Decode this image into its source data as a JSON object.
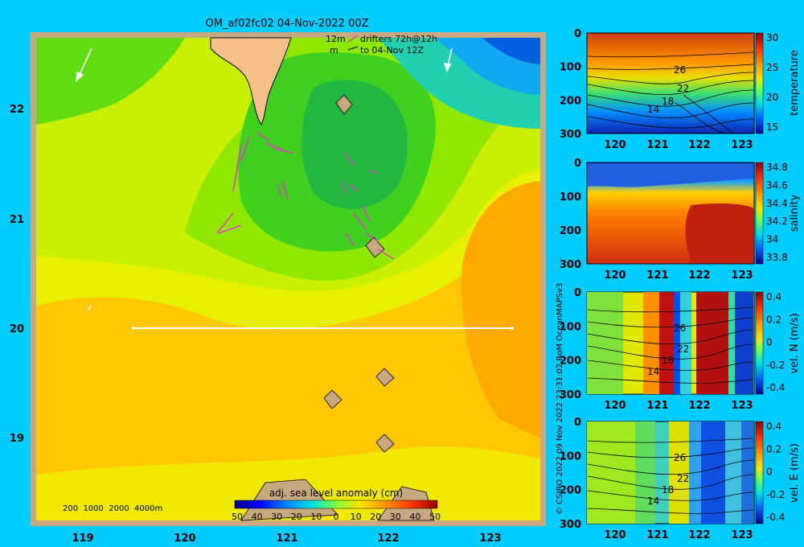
{
  "header": {
    "title": "OM_af02fc02 04-Nov-2022 00Z",
    "legend_line1_left": "12m",
    "legend_line1_right": "drifters 72h@12h",
    "legend_line2_left": "m",
    "legend_line2_right": "to 04-Nov 12Z"
  },
  "map": {
    "x_ticks": [
      "119",
      "120",
      "121",
      "122",
      "123"
    ],
    "y_ticks": [
      "22",
      "21",
      "20",
      "19"
    ],
    "depth_legend": "200  1000  2000  4000m",
    "colorbar_title": "adj. sea level anomaly (cm)",
    "colorbar_ticks": [
      "-50",
      "-40",
      "-30",
      "-20",
      "-10",
      "0",
      "10",
      "20",
      "30",
      "40",
      "50"
    ],
    "section": {
      "from_lon": 119.5,
      "to_lon": 123.2,
      "lat": 20.0
    }
  },
  "panels": {
    "x_ticks": [
      "120",
      "121",
      "122",
      "123"
    ],
    "depth_ticks": [
      "0",
      "100",
      "200",
      "300"
    ],
    "temperature": {
      "label": "temperature",
      "cbar_ticks": [
        "30",
        "25",
        "20",
        "15"
      ],
      "contour_labels": [
        "26",
        "22",
        "18",
        "14"
      ]
    },
    "salinity": {
      "label": "salinity",
      "cbar_ticks": [
        "34.8",
        "34.6",
        "34.4",
        "34.2",
        "34",
        "33.8"
      ]
    },
    "vel_n": {
      "label": "vel. N (m/s)",
      "cbar_ticks": [
        "0.4",
        "0.2",
        "0",
        "-0.2",
        "-0.4"
      ],
      "contour_labels": [
        "26",
        "22",
        "18",
        "14"
      ]
    },
    "vel_e": {
      "label": "vel. E (m/s)",
      "cbar_ticks": [
        "0.4",
        "0.2",
        "0",
        "-0.2",
        "-0.4"
      ],
      "contour_labels": [
        "26",
        "22",
        "18",
        "14"
      ]
    }
  },
  "credits": "© CSIRO 2022   09 Nov 2022 23:31:02 BoM OceanMAPSv3"
}
